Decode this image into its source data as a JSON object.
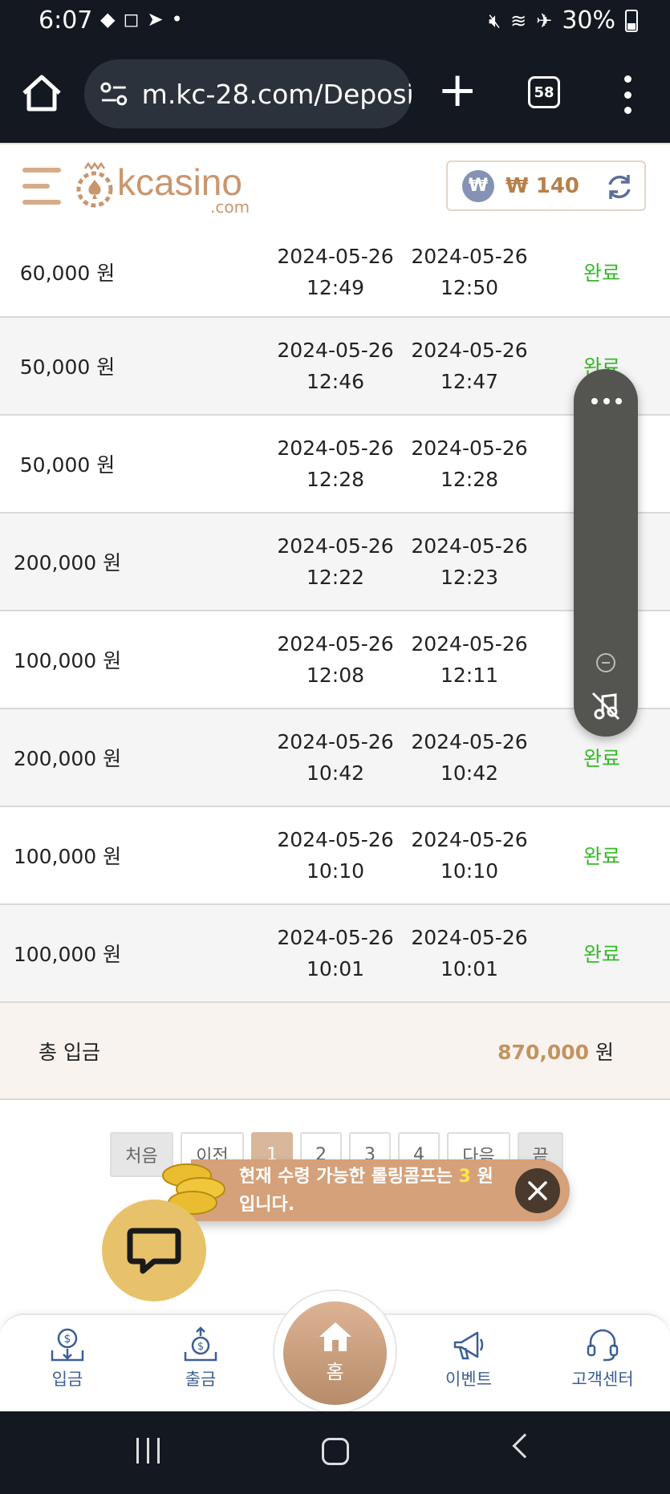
{
  "status_bar": {
    "time": "6:07",
    "battery": "30%"
  },
  "browser": {
    "url": "m.kc-28.com/Deposi",
    "tab_count": "58"
  },
  "header": {
    "logo_text": "kcasino",
    "logo_sub": ".com",
    "currency_symbol": "₩",
    "balance": "₩ 140"
  },
  "deposits": [
    {
      "amount": "60,000 원",
      "req_date": "2024-05-26",
      "req_time": "12:49",
      "done_date": "2024-05-26",
      "done_time": "12:50",
      "status": "완료"
    },
    {
      "amount": "50,000 원",
      "req_date": "2024-05-26",
      "req_time": "12:46",
      "done_date": "2024-05-26",
      "done_time": "12:47",
      "status": "완료"
    },
    {
      "amount": "50,000 원",
      "req_date": "2024-05-26",
      "req_time": "12:28",
      "done_date": "2024-05-26",
      "done_time": "12:28",
      "status": ""
    },
    {
      "amount": "200,000 원",
      "req_date": "2024-05-26",
      "req_time": "12:22",
      "done_date": "2024-05-26",
      "done_time": "12:23",
      "status": ""
    },
    {
      "amount": "100,000 원",
      "req_date": "2024-05-26",
      "req_time": "12:08",
      "done_date": "2024-05-26",
      "done_time": "12:11",
      "status": ""
    },
    {
      "amount": "200,000 원",
      "req_date": "2024-05-26",
      "req_time": "10:42",
      "done_date": "2024-05-26",
      "done_time": "10:42",
      "status": "완료"
    },
    {
      "amount": "100,000 원",
      "req_date": "2024-05-26",
      "req_time": "10:10",
      "done_date": "2024-05-26",
      "done_time": "10:10",
      "status": "완료"
    },
    {
      "amount": "100,000 원",
      "req_date": "2024-05-26",
      "req_time": "10:01",
      "done_date": "2024-05-26",
      "done_time": "10:01",
      "status": "완료"
    }
  ],
  "total": {
    "label": "총 입금",
    "value": "870,000",
    "unit": "원"
  },
  "pagination": {
    "first": "처음",
    "prev": "이전",
    "pages": [
      "1",
      "2",
      "3",
      "4"
    ],
    "next": "다음",
    "last": "끝"
  },
  "toast": {
    "text_before": "현재 수령 가능한 롤링콤프는 ",
    "highlight": "3",
    "text_after": " 원 입니다."
  },
  "nav": {
    "deposit": "입금",
    "withdraw": "출금",
    "home": "홈",
    "event": "이벤트",
    "support": "고객센터"
  },
  "colors": {
    "accent": "#d5a17a",
    "status_done": "#36b928",
    "nav_text": "#3b5f95"
  }
}
